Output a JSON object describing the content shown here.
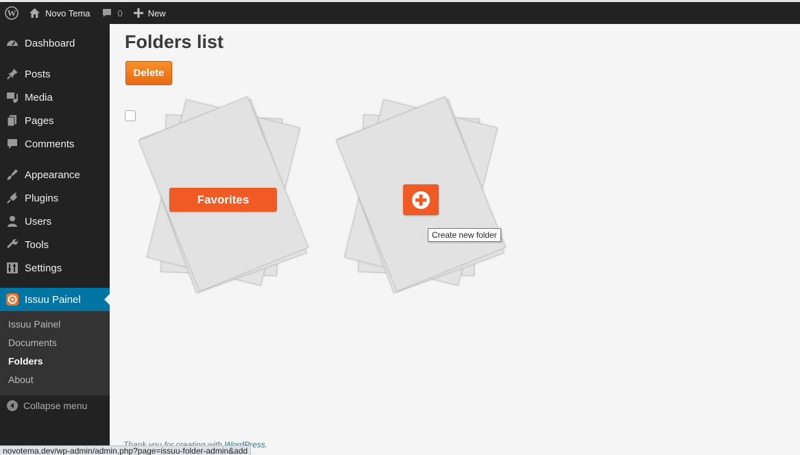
{
  "admin_bar": {
    "site_name": "Novo Tema",
    "comments_count": "0",
    "new_label": "New"
  },
  "sidebar": {
    "items": [
      {
        "label": "Dashboard",
        "icon": "dashboard-icon"
      },
      {
        "label": "Posts",
        "icon": "pin-icon"
      },
      {
        "label": "Media",
        "icon": "media-icon"
      },
      {
        "label": "Pages",
        "icon": "pages-icon"
      },
      {
        "label": "Comments",
        "icon": "comment-icon"
      },
      {
        "label": "Appearance",
        "icon": "brush-icon"
      },
      {
        "label": "Plugins",
        "icon": "plug-icon"
      },
      {
        "label": "Users",
        "icon": "user-icon"
      },
      {
        "label": "Tools",
        "icon": "wrench-icon"
      },
      {
        "label": "Settings",
        "icon": "settings-icon"
      },
      {
        "label": "Issuu Painel",
        "icon": "issuu-icon",
        "active": true
      }
    ],
    "submenu": [
      "Issuu Painel",
      "Documents",
      "Folders",
      "About"
    ],
    "submenu_current": "Folders",
    "collapse_label": "Collapse menu"
  },
  "main": {
    "title": "Folders list",
    "delete_label": "Delete",
    "folders": [
      {
        "name": "Favorites"
      }
    ],
    "create_tooltip": "Create new folder",
    "footer_prefix": "Thank you for creating with ",
    "footer_link": "WordPress",
    "footer_suffix": "."
  },
  "status_url": "novotema.dev/wp-admin/admin.php?page=issuu-folder-admin&add",
  "colors": {
    "accent_orange": "#f05a24",
    "admin_blue": "#0074a2",
    "sidebar_bg": "#222222"
  }
}
